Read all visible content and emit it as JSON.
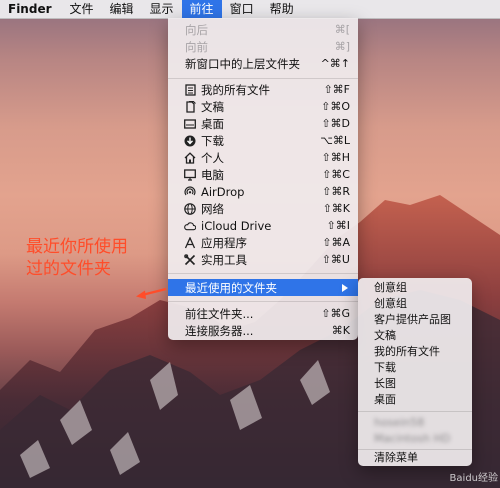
{
  "menubar": {
    "app": "Finder",
    "items": [
      "文件",
      "编辑",
      "显示",
      "前往",
      "窗口",
      "帮助"
    ]
  },
  "go_menu": {
    "back": {
      "label": "向后",
      "shortcut": "⌘["
    },
    "forward": {
      "label": "向前",
      "shortcut": "⌘]"
    },
    "enclosing": {
      "label": "新窗口中的上层文件夹",
      "shortcut": "^⌘↑"
    },
    "places": [
      {
        "label": "我的所有文件",
        "shortcut": "⇧⌘F",
        "icon": "all-files-icon"
      },
      {
        "label": "文稿",
        "shortcut": "⇧⌘O",
        "icon": "documents-icon"
      },
      {
        "label": "桌面",
        "shortcut": "⇧⌘D",
        "icon": "desktop-icon"
      },
      {
        "label": "下载",
        "shortcut": "⌥⌘L",
        "icon": "downloads-icon"
      },
      {
        "label": "个人",
        "shortcut": "⇧⌘H",
        "icon": "home-icon"
      },
      {
        "label": "电脑",
        "shortcut": "⇧⌘C",
        "icon": "computer-icon"
      },
      {
        "label": "AirDrop",
        "shortcut": "⇧⌘R",
        "icon": "airdrop-icon"
      },
      {
        "label": "网络",
        "shortcut": "⇧⌘K",
        "icon": "network-icon"
      },
      {
        "label": "iCloud Drive",
        "shortcut": "⇧⌘I",
        "icon": "cloud-icon"
      },
      {
        "label": "应用程序",
        "shortcut": "⇧⌘A",
        "icon": "applications-icon"
      },
      {
        "label": "实用工具",
        "shortcut": "⇧⌘U",
        "icon": "utilities-icon"
      }
    ],
    "recent": {
      "label": "最近使用的文件夹"
    },
    "goto_folder": {
      "label": "前往文件夹...",
      "shortcut": "⇧⌘G"
    },
    "connect": {
      "label": "连接服务器...",
      "shortcut": "⌘K"
    }
  },
  "recent_submenu": {
    "items": [
      "创意组",
      "创意组",
      "客户提供产品图",
      "文稿",
      "我的所有文件",
      "下载",
      "长图",
      "桌面"
    ],
    "blurred": [
      "hosein58",
      "Macintosh HD"
    ],
    "clear": "清除菜单"
  },
  "annotation": {
    "line1": "最近你所使用",
    "line2": "过的文件夹",
    "color": "#ff4d2a"
  },
  "watermark": "Baidu经验",
  "colors": {
    "accent": "#2f74e8"
  }
}
